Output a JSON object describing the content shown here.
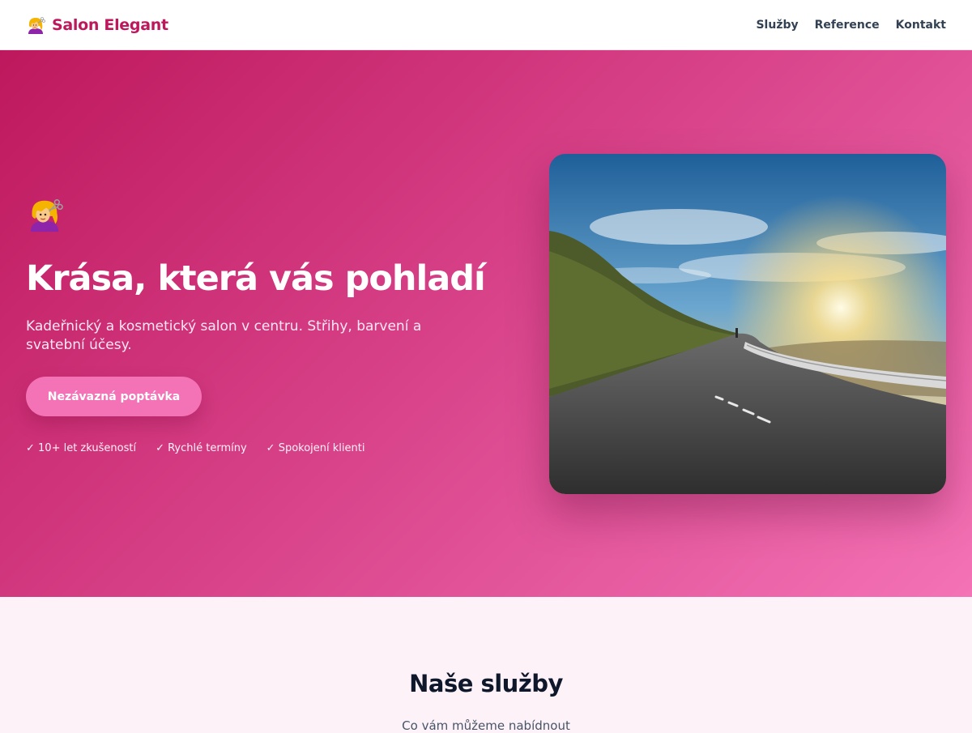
{
  "header": {
    "brand": "Salon Elegant",
    "brand_icon": "hairdresser-icon",
    "nav": [
      "Služby",
      "Reference",
      "Kontakt"
    ]
  },
  "hero": {
    "icon": "hairdresser-icon",
    "title": "Krása, která vás pohladí",
    "subtitle": "Kadeřnický a kosmetický salon v centru. Střihy, barvení a svatební účesy.",
    "cta_label": "Nezávazná poptávka",
    "features": [
      "✓ 10+ let zkušeností",
      "✓ Rychlé termíny",
      "✓ Spokojení klienti"
    ],
    "image": "sunset-road-photo"
  },
  "services": {
    "title": "Naše služby",
    "subtitle": "Co vám můžeme nabídnout"
  },
  "colors": {
    "brand": "#be185d",
    "accent": "#f472b6",
    "hero_gradient_start": "#be185d",
    "hero_gradient_end": "#f472b6",
    "section_background": "#fdf2f8"
  }
}
